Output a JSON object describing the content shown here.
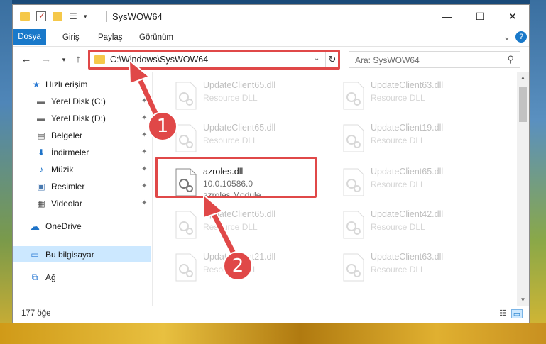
{
  "window": {
    "title": "SysWOW64",
    "minimize_glyph": "—",
    "maximize_glyph": "☐",
    "close_glyph": "✕"
  },
  "ribbon": {
    "tabs": [
      "Dosya",
      "Giriş",
      "Paylaş",
      "Görünüm"
    ],
    "collapse_glyph": "⌄",
    "help_glyph": "?"
  },
  "address": {
    "path": "C:\\Windows\\SysWOW64",
    "search_placeholder": "Ara: SysWOW64"
  },
  "sidebar": {
    "items": [
      {
        "label": "Hızlı erişim",
        "icon": "star-icon",
        "glyph": "★",
        "pinned": false
      },
      {
        "label": "Yerel Disk (C:)",
        "icon": "drive-icon",
        "glyph": "▬",
        "pinned": true
      },
      {
        "label": "Yerel Disk (D:)",
        "icon": "drive-icon",
        "glyph": "▬",
        "pinned": true
      },
      {
        "label": "Belgeler",
        "icon": "documents-icon",
        "glyph": "▤",
        "pinned": true
      },
      {
        "label": "İndirmeler",
        "icon": "download-icon",
        "glyph": "⬇",
        "pinned": true
      },
      {
        "label": "Müzik",
        "icon": "music-icon",
        "glyph": "♪",
        "pinned": true
      },
      {
        "label": "Resimler",
        "icon": "pictures-icon",
        "glyph": "▣",
        "pinned": true
      },
      {
        "label": "Videolar",
        "icon": "video-icon",
        "glyph": "▦",
        "pinned": true
      },
      {
        "label": "OneDrive",
        "icon": "cloud-icon",
        "glyph": "☁",
        "pinned": false
      },
      {
        "label": "Bu bilgisayar",
        "icon": "computer-icon",
        "glyph": "▭",
        "pinned": false
      },
      {
        "label": "Ağ",
        "icon": "network-icon",
        "glyph": "⧉",
        "pinned": false
      }
    ],
    "pin_glyph": "📌"
  },
  "files": [
    {
      "name": "UpdateClient65.dll",
      "line1": "Resource DLL",
      "line2": ""
    },
    {
      "name": "UpdateClient63.dll",
      "line1": "Resource DLL",
      "line2": ""
    },
    {
      "name": "UpdateClient65.dll",
      "line1": "Resource DLL",
      "line2": ""
    },
    {
      "name": "UpdateClient19.dll",
      "line1": "Resource DLL",
      "line2": ""
    },
    {
      "name": "azroles.dll",
      "line1": "10.0.10586.0",
      "line2": "azroles Module"
    },
    {
      "name": "UpdateClient65.dll",
      "line1": "Resource DLL",
      "line2": ""
    },
    {
      "name": "UpdateClient65.dll",
      "line1": "Resource DLL",
      "line2": ""
    },
    {
      "name": "UpdateClient42.dll",
      "line1": "Resource DLL",
      "line2": ""
    },
    {
      "name": "UpdateClient21.dll",
      "line1": "Resource DLL",
      "line2": ""
    },
    {
      "name": "UpdateClient63.dll",
      "line1": "Resource DLL",
      "line2": ""
    }
  ],
  "status": {
    "item_count": "177 öğe"
  },
  "annotations": {
    "badge1": "1",
    "badge2": "2",
    "color": "#e04848"
  }
}
